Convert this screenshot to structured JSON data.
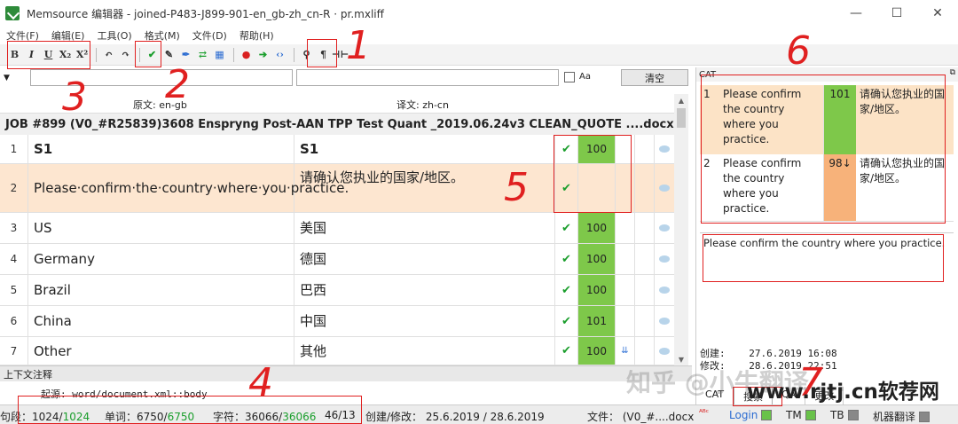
{
  "window": {
    "title": "Memsource 编辑器 - joined-P483-J899-901-en_gb-zh_cn-R · pr.mxliff",
    "minimize": "—",
    "maximize": "☐",
    "close": "✕"
  },
  "menu": [
    "文件(F)",
    "编辑(E)",
    "工具(O)",
    "格式(M)",
    "文件(D)",
    "帮助(H)"
  ],
  "toolbar": {
    "bold": "B",
    "italic": "I",
    "underline": "U",
    "subscript": "X₂",
    "superscript": "X²",
    "pilcrow": "¶"
  },
  "filter": {
    "clear_label": "清空",
    "aa_label": "Aa"
  },
  "grid": {
    "source_header": "原文: en-gb",
    "target_header": "译文: zh-cn",
    "job_title": "JOB #899   (V0_#R25839)3608 Enspryng Post-AAN TPP Test Quant _2019.06.24v3 CLEAN_QUOTE ....docx",
    "rows": [
      {
        "num": "1",
        "source": "S1",
        "target": "S1",
        "score": "100"
      },
      {
        "num": "2",
        "source": "Please·confirm·the·country·where·you·practice.",
        "target": "请确认您执业的国家/地区。",
        "score": ""
      },
      {
        "num": "3",
        "source": "US",
        "target": "美国",
        "score": "100"
      },
      {
        "num": "4",
        "source": "Germany",
        "target": "德国",
        "score": "100"
      },
      {
        "num": "5",
        "source": "Brazil",
        "target": "巴西",
        "score": "100"
      },
      {
        "num": "6",
        "source": "China",
        "target": "中国",
        "score": "101"
      },
      {
        "num": "7",
        "source": "Other",
        "target": "其他",
        "score": "100"
      }
    ]
  },
  "context": {
    "header": "上下文注释",
    "source": "起源:  word/document.xml::body"
  },
  "status": {
    "segments_label": "句段：1024/",
    "segments_value": "1024",
    "words_label": "单词：6750/",
    "words_value": "6750",
    "chars_label": "字符：36066/",
    "chars_value": "36066",
    "ratio": "46/13",
    "dates": "创建/修改：  25.6.2019 / 28.6.2019",
    "file": "文件：  (V0_#....docx",
    "login": "Login",
    "tm": "TM",
    "tb": "TB",
    "mt": "机器翻译"
  },
  "cat": {
    "title": "CAT",
    "matches": [
      {
        "num": "1",
        "source": "Please confirm the country where you practice.",
        "score": "101",
        "target": "请确认您执业的国家/地区。"
      },
      {
        "num": "2",
        "source": "Please confirm the country where you practice.",
        "score": "98↓",
        "target": "请确认您执业的国家/地区。"
      }
    ],
    "preview": "Please confirm the country where you practice.",
    "created_label": "创建:",
    "created_value": "27.6.2019 16:08",
    "modified_label": "修改:",
    "modified_value": "28.6.2019 22:51",
    "tabs": [
      "CAT",
      "搜索",
      "QA",
      "更改"
    ]
  },
  "annotations": [
    "1",
    "2",
    "3",
    "4",
    "5",
    "6",
    "7"
  ],
  "watermark": {
    "text": "知乎 @小牛翻译 ...",
    "url": "www.rjtj.cn软荐网"
  },
  "colors": {
    "match_green": "#7ec84a",
    "match_orange": "#f7b27a",
    "active_row": "#fde6d0",
    "annotation_red": "#e02020"
  }
}
